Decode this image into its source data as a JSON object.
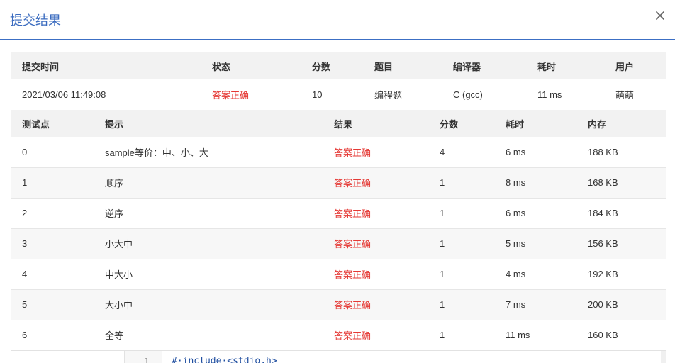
{
  "dialog": {
    "title": "提交结果",
    "close_glyph": "×"
  },
  "summary": {
    "headers": [
      "提交时间",
      "状态",
      "分数",
      "题目",
      "编译器",
      "耗时",
      "用户"
    ],
    "row": [
      "2021/03/06 11:49:08",
      "答案正确",
      "10",
      "编程题",
      "C (gcc)",
      "11 ms",
      "萌萌"
    ]
  },
  "cases": {
    "headers": [
      "测试点",
      "提示",
      "结果",
      "分数",
      "耗时",
      "内存"
    ],
    "rows": [
      [
        "0",
        "sample等价：中、小、大",
        "答案正确",
        "4",
        "6 ms",
        "188 KB"
      ],
      [
        "1",
        "顺序",
        "答案正确",
        "1",
        "8 ms",
        "168 KB"
      ],
      [
        "2",
        "逆序",
        "答案正确",
        "1",
        "6 ms",
        "184 KB"
      ],
      [
        "3",
        "小大中",
        "答案正确",
        "1",
        "5 ms",
        "156 KB"
      ],
      [
        "4",
        "中大小",
        "答案正确",
        "1",
        "4 ms",
        "192 KB"
      ],
      [
        "5",
        "大小中",
        "答案正确",
        "1",
        "7 ms",
        "200 KB"
      ],
      [
        "6",
        "全等",
        "答案正确",
        "1",
        "11 ms",
        "160 KB"
      ]
    ]
  },
  "code": {
    "line_number": "1",
    "first_line": "#·include·<stdio.h>"
  },
  "colors": {
    "accent": "#3a6bbf",
    "accepted": "#e53935"
  }
}
